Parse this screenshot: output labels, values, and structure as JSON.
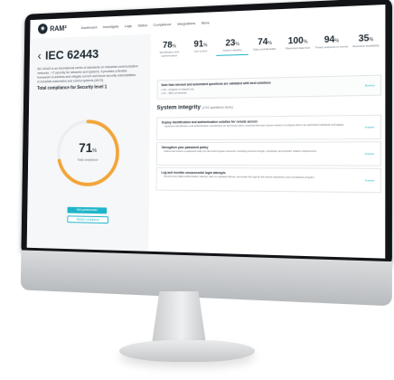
{
  "brand": {
    "name": "RAM²",
    "accent": "#1fb5c9",
    "ring_color": "#f3a53a"
  },
  "nav": {
    "items": [
      "Dashboard",
      "Investigate",
      "Logs",
      "Status",
      "Compliance",
      "Integrations",
      "More"
    ]
  },
  "left_panel": {
    "back_icon": "chevron-left-icon",
    "title": "IEC 62443",
    "description": "IEC 62443 is an international series of standards on Industrial communication networks – IT security for networks and systems. It provides a flexible framework to address and mitigate current and future security vulnerabilities in industrial automation and control systems (IACS).",
    "total_label": "Total compliance for Security level 1",
    "total_value": 71,
    "total_pct_sign": "%",
    "total_caption": "Total compliance",
    "primary_button": "Edit questionnaire",
    "secondary_button": "Assess compliance"
  },
  "stats": [
    {
      "value": "78",
      "label": "Identification and authentication"
    },
    {
      "value": "91",
      "label": "Use control"
    },
    {
      "value": "23",
      "label": "System integrity",
      "active": true
    },
    {
      "value": "74",
      "label": "Data confidentiality"
    },
    {
      "value": "100",
      "label": "Restricted data flow"
    },
    {
      "value": "94",
      "label": "Timely response to events"
    },
    {
      "value": "35",
      "label": "Resource availability"
    }
  ],
  "stat_pct_sign": "%",
  "note": {
    "title": "Note that relevant and automated questions are validated with best solutions",
    "line1": "1.10 – Analysis of network use",
    "line2": "1.11 – SBC connectivity",
    "link": "Review"
  },
  "section": {
    "title": "System integrity",
    "subtitle": "(1/10 questions done)"
  },
  "cards": [
    {
      "title": "Deploy identification and authentication solution for remote access",
      "body": "Implement identification and authentication mechanisms for all remote users, ensuring that each access session is uniquely tied to an authorized individual and logged.",
      "link": "Answer"
    },
    {
      "title": "Strengthen your password policy",
      "body": "Define and enforce a password policy for all control system accounts, including minimum length, complexity and periodic rotation requirements.",
      "link": "Answer"
    },
    {
      "title": "Log and monitor unsuccessful login attempts",
      "body": "Record every failed authentication attempt, alert on repeated failures, and retain the logs for the period required by your compliance program.",
      "link": "Answer"
    }
  ]
}
